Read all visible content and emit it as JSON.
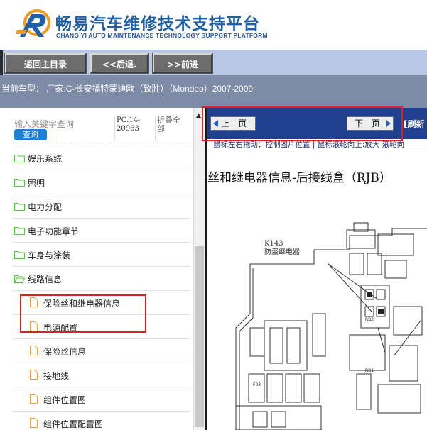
{
  "header": {
    "title": "畅易汽车维修技术支持平台",
    "subtitle": "CHANG YI AUTO MAINTENANCE TECHNOLOGY SUPPORT PLATFORM"
  },
  "nav": {
    "home_label": "返回主目录",
    "back_label": "<<后退.",
    "forward_label": ">>前进"
  },
  "model_bar": {
    "text": "当前车型：  厂家:C-长安福特蒙迪欧（致胜）（Mondeo）2007-2009"
  },
  "sidebar": {
    "search_placeholder": "输入关键字查询",
    "search_button": "查询",
    "pc_code": "PC.14-20963",
    "collapse_all": "折叠全部",
    "folders": [
      {
        "label": "娱乐系统"
      },
      {
        "label": "照明"
      },
      {
        "label": "电力分配"
      },
      {
        "label": "电子功能章节"
      },
      {
        "label": "车身与涂装"
      },
      {
        "label": "线路信息"
      }
    ],
    "docs": [
      {
        "label": "保险丝和继电器信息"
      },
      {
        "label": "电源配置"
      },
      {
        "label": "保险丝信息"
      },
      {
        "label": "接地线"
      },
      {
        "label": "组件位置图"
      },
      {
        "label": "组件位置配置图"
      }
    ]
  },
  "viewer": {
    "prev_label": "上一页",
    "next_label": "下一页",
    "refresh_label": "[刷新",
    "hint": "鼠标左右拖动：控制图片位置 | 鼠标滚轮向上:放大   滚轮向",
    "doc_title": "丝和继电器信息-后接线盒（RJB）",
    "component_code": "K143",
    "component_name": "防盗继电器",
    "labels": [
      "RB2",
      "RB1",
      "F03"
    ]
  },
  "colors": {
    "brand_blue": "#1f5fa8",
    "nav_bg": "#b9c7e6",
    "model_bar_bg": "#7e8ba6",
    "viewer_bar_bg": "#1f3f8f",
    "highlight_red": "#e02020",
    "folder_green": "#5cbf4a",
    "doc_orange": "#f0a040"
  }
}
